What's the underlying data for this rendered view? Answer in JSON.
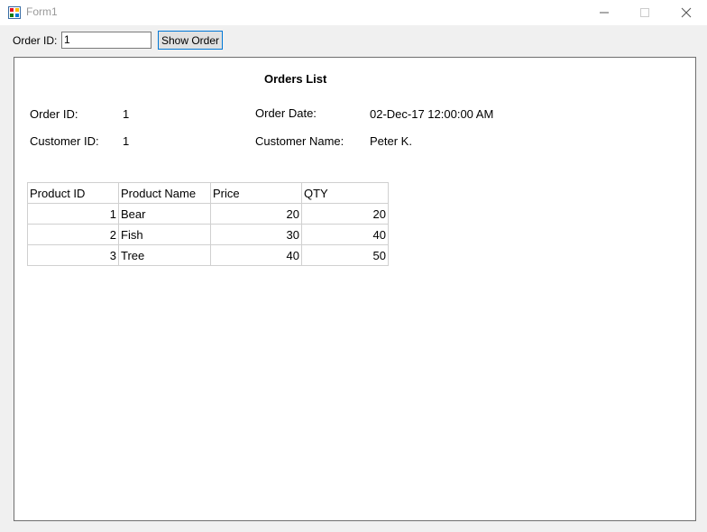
{
  "window": {
    "title": "Form1",
    "icon": "winforms-app-icon",
    "controls": [
      "minimize-icon",
      "maximize-icon",
      "close-icon"
    ]
  },
  "toolbar": {
    "order_id_label": "Order ID:",
    "order_id_value": "1",
    "show_button_label": "Show Order"
  },
  "report": {
    "title": "Orders List",
    "order_id_label": "Order ID:",
    "order_id_value": "1",
    "customer_id_label": "Customer ID:",
    "customer_id_value": "1",
    "order_date_label": "Order Date:",
    "order_date_value": "02-Dec-17 12:00:00 AM",
    "customer_name_label": "Customer Name:",
    "customer_name_value": "Peter K."
  },
  "table": {
    "headers": [
      "Product ID",
      "Product Name",
      "Price",
      "QTY"
    ],
    "rows": [
      [
        "1",
        "Bear",
        "20",
        "20"
      ],
      [
        "2",
        "Fish",
        "30",
        "40"
      ],
      [
        "3",
        "Tree",
        "40",
        "50"
      ]
    ]
  },
  "colors": {
    "button_focus_border": "#0078d7",
    "form_background": "#f0f0f0"
  }
}
